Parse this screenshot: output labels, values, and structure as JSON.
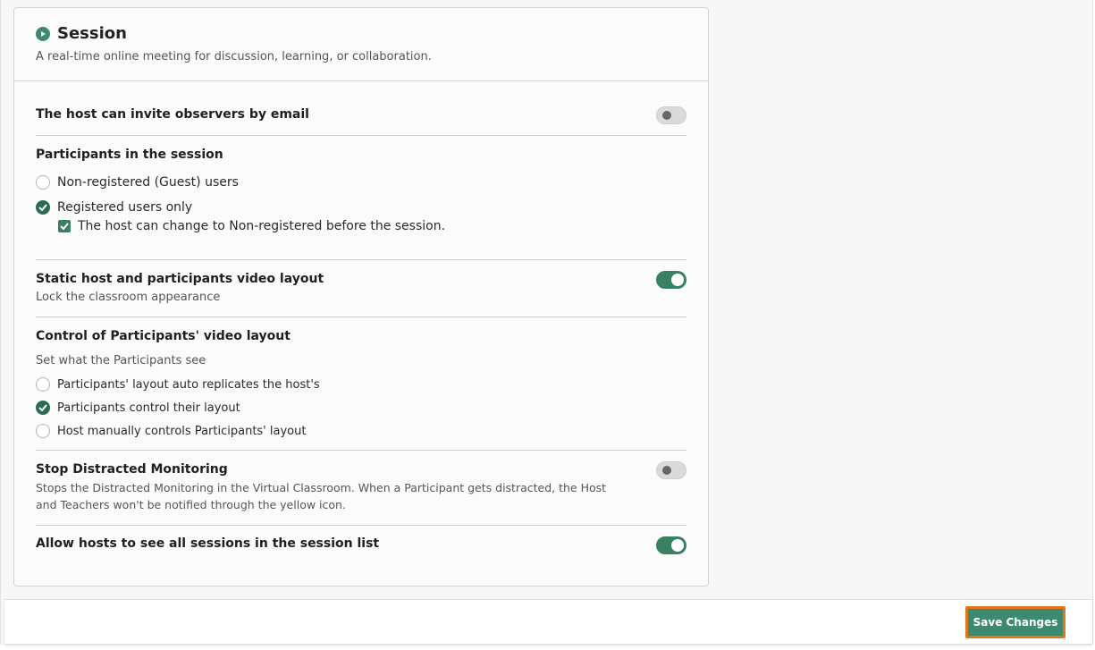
{
  "section": {
    "title": "Session",
    "subtitle": "A real-time online meeting for discussion, learning, or collaboration."
  },
  "settings": {
    "invite_observers": {
      "title": "The host can invite observers by email",
      "enabled": false
    },
    "participants": {
      "title": "Participants in the session",
      "options": [
        {
          "label": "Non-registered (Guest) users",
          "selected": false
        },
        {
          "label": "Registered users only",
          "selected": true
        }
      ],
      "sub_checkbox": {
        "label": "The host can change to Non-registered before the session.",
        "checked": true
      }
    },
    "static_layout": {
      "title": "Static host and participants video layout",
      "description": "Lock the classroom appearance",
      "enabled": true
    },
    "control_layout": {
      "title": "Control of Participants' video layout",
      "description": "Set what the Participants see",
      "options": [
        {
          "label": "Participants' layout auto replicates the host's",
          "selected": false
        },
        {
          "label": "Participants control their layout",
          "selected": true
        },
        {
          "label": "Host manually controls Participants' layout",
          "selected": false
        }
      ]
    },
    "distracted": {
      "title": "Stop Distracted Monitoring",
      "description_line1": "Stops the Distracted Monitoring in the Virtual Classroom. When a Participant gets distracted, the Host",
      "description_line2": "and Teachers won't be notified through the yellow icon.",
      "enabled": false
    },
    "see_all_sessions": {
      "title": "Allow hosts to see all sessions in the session list",
      "enabled": true
    }
  },
  "footer": {
    "save_label": "Save Changes"
  },
  "colors": {
    "accent": "#3d8a6e",
    "highlight_border": "#e0781e"
  }
}
